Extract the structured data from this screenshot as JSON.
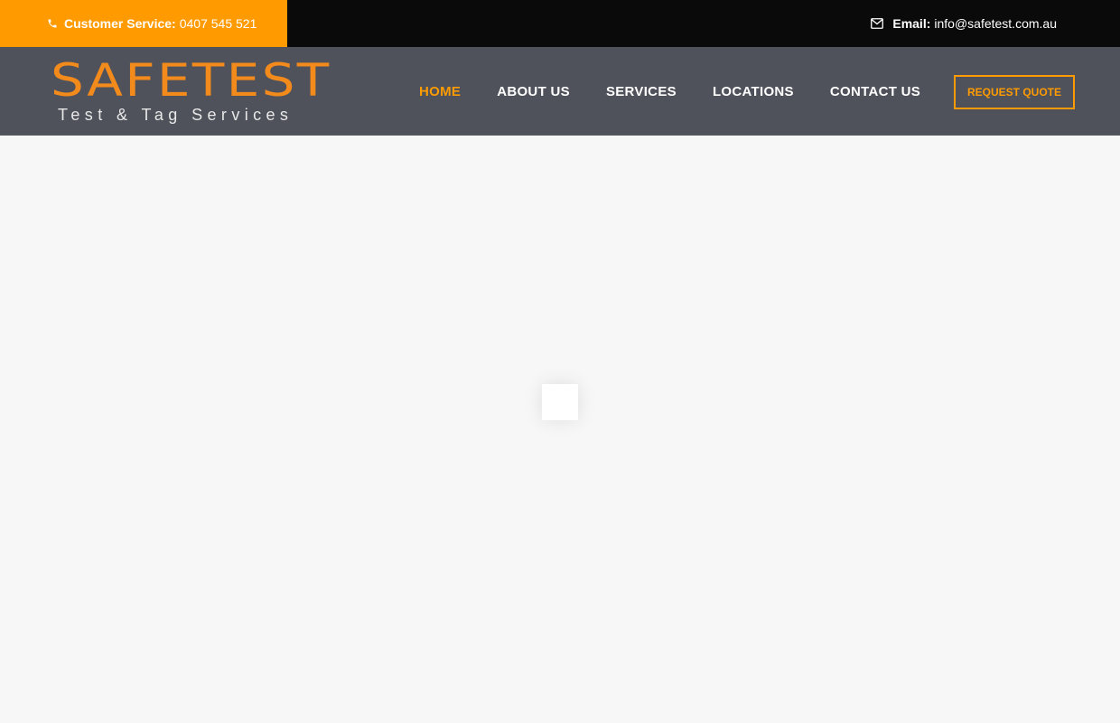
{
  "topbar": {
    "phone_icon": "phone-icon",
    "customer_service_label": "Customer Service:",
    "phone": "0407 545 521",
    "mail_icon": "envelope-icon",
    "email_label": "Email:",
    "email": "info@safetest.com.au"
  },
  "logo": {
    "main": "SAFETEST",
    "sub": "Test & Tag Services"
  },
  "nav": {
    "items": [
      {
        "label": "HOME",
        "active": true
      },
      {
        "label": "ABOUT US"
      },
      {
        "label": "SERVICES"
      },
      {
        "label": "LOCATIONS"
      },
      {
        "label": "CONTACT US"
      }
    ],
    "cta": "REQUEST QUOTE"
  },
  "colors": {
    "accent": "#ff9b00",
    "topbar_bg": "#0a0a0a",
    "nav_bg": "#4f525b",
    "page_bg": "#f7f7f7"
  }
}
